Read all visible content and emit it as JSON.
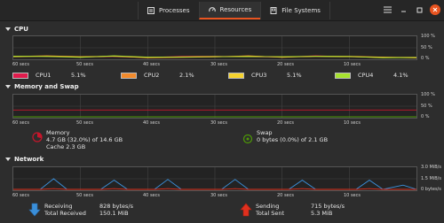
{
  "tabs": [
    {
      "label": "Processes",
      "icon": "processes-icon"
    },
    {
      "label": "Resources",
      "icon": "resources-icon"
    },
    {
      "label": "File Systems",
      "icon": "file-systems-icon"
    }
  ],
  "colors": {
    "accent": "#e95420",
    "cpu1": "#e01b4c",
    "cpu2": "#f28a2b",
    "cpu3": "#f6d32d",
    "cpu4": "#a6e22e",
    "memory": "#c7162b",
    "swap": "#4e9a06",
    "receiving": "#3a8fd9",
    "sending": "#e0301e"
  },
  "cpu": {
    "title": "CPU",
    "y_labels": [
      "100 %",
      "50 %",
      "0 %"
    ],
    "x_labels": [
      "60 secs",
      "50 secs",
      "40 secs",
      "30 secs",
      "20 secs",
      "10 secs"
    ],
    "legend": [
      {
        "name": "CPU1",
        "value": "5.1%"
      },
      {
        "name": "CPU2",
        "value": "2.1%"
      },
      {
        "name": "CPU3",
        "value": "5.1%"
      },
      {
        "name": "CPU4",
        "value": "4.1%"
      }
    ]
  },
  "memory": {
    "title": "Memory and Swap",
    "y_labels": [
      "100 %",
      "50 %",
      "0 %"
    ],
    "x_labels": [
      "60 secs",
      "50 secs",
      "40 secs",
      "30 secs",
      "20 secs",
      "10 secs"
    ],
    "mem_label": "Memory",
    "mem_usage": "4.7 GB (32.0%) of 14.6 GB",
    "mem_cache": "Cache 2.3 GB",
    "swap_label": "Swap",
    "swap_usage": "0 bytes (0.0%) of 2.1 GB"
  },
  "network": {
    "title": "Network",
    "y_labels": [
      "3.0 MiB/s",
      "1.5 MiB/s",
      "0 bytes/s"
    ],
    "x_labels": [
      "60 secs",
      "50 secs",
      "40 secs",
      "30 secs",
      "20 secs",
      "10 secs"
    ],
    "receiving_label": "Receiving",
    "receiving_value": "828 bytes/s",
    "total_received_label": "Total Received",
    "total_received_value": "150.1 MiB",
    "sending_label": "Sending",
    "sending_value": "715 bytes/s",
    "total_sent_label": "Total Sent",
    "total_sent_value": "5.3 MiB"
  },
  "chart_data": [
    {
      "type": "line",
      "title": "CPU",
      "x": [
        60,
        55,
        50,
        45,
        40,
        35,
        30,
        25,
        20,
        15,
        10,
        5,
        0
      ],
      "ylim": [
        0,
        100
      ],
      "series": [
        {
          "name": "CPU1",
          "values": [
            10,
            11,
            6,
            9,
            4,
            9,
            10,
            8,
            6,
            12,
            8,
            4,
            5
          ]
        },
        {
          "name": "CPU2",
          "values": [
            9,
            12,
            8,
            11,
            3,
            5,
            7,
            12,
            5,
            11,
            10,
            6,
            2
          ]
        },
        {
          "name": "CPU3",
          "values": [
            8,
            10,
            7,
            10,
            5,
            7,
            8,
            10,
            7,
            9,
            8,
            5,
            5
          ]
        },
        {
          "name": "CPU4",
          "values": [
            11,
            9,
            5,
            12,
            6,
            6,
            9,
            8,
            8,
            10,
            9,
            3,
            4
          ]
        }
      ]
    },
    {
      "type": "line",
      "title": "Memory and Swap",
      "x": [
        60,
        0
      ],
      "ylim": [
        0,
        100
      ],
      "series": [
        {
          "name": "Memory",
          "values": [
            32,
            32
          ]
        },
        {
          "name": "Swap",
          "values": [
            0,
            0
          ]
        }
      ]
    },
    {
      "type": "line",
      "title": "Network",
      "x": [
        60,
        56,
        54,
        52,
        47,
        45,
        43,
        39,
        37,
        35,
        29,
        27,
        25,
        19,
        17,
        15,
        9,
        7,
        5,
        2,
        0
      ],
      "ylim": [
        0,
        3.0
      ],
      "series": [
        {
          "name": "Receiving",
          "values": [
            0,
            0,
            1.5,
            0,
            0,
            1.3,
            0,
            0,
            1.4,
            0,
            0,
            1.4,
            0,
            0,
            1.3,
            0,
            0,
            1.3,
            0,
            0.6,
            0
          ]
        },
        {
          "name": "Sending",
          "values": [
            0,
            0,
            0.1,
            0,
            0,
            0.1,
            0,
            0,
            0.1,
            0,
            0,
            0.1,
            0,
            0,
            0.1,
            0,
            0,
            0.1,
            0,
            0,
            0
          ]
        }
      ]
    }
  ]
}
